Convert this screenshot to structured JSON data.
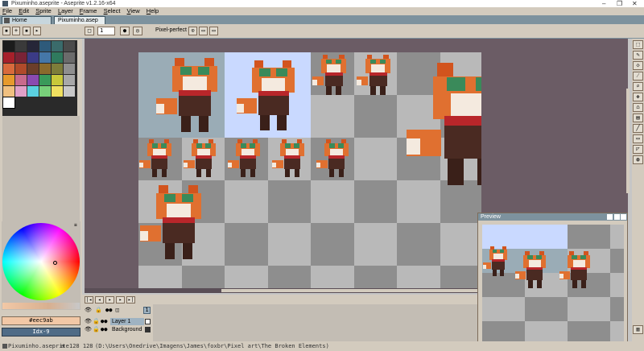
{
  "window": {
    "title": "Pixuminho.aseprite - Aseprite v1.2.16-x64",
    "controls": [
      "–",
      "❐",
      "✕"
    ]
  },
  "menu": [
    "File",
    "Edit",
    "Sprite",
    "Layer",
    "Frame",
    "Select",
    "View",
    "Help"
  ],
  "tabs": [
    {
      "label": "Home"
    },
    {
      "label": "Pixuminho.asep"
    }
  ],
  "context": {
    "brush_size": "1",
    "pixel_perfect_label": "Pixel-perfect"
  },
  "palette": {
    "colors": [
      "#1c1c1c",
      "#3a3a3a",
      "#262638",
      "#2e5a7a",
      "#3a6b6b",
      "#4b4b4b",
      "#a6202a",
      "#7a2336",
      "#3b3b86",
      "#4577a8",
      "#2f7a5e",
      "#6b6b6b",
      "#d86a3c",
      "#b04a2a",
      "#6b3e2a",
      "#8a6a2c",
      "#7d7d3a",
      "#8f8f8f",
      "#e69a2c",
      "#c86a8c",
      "#8a4ab0",
      "#3a9a5a",
      "#c8c83a",
      "#a8a8a8",
      "#f0c080",
      "#e0a0c8",
      "#5ad0e0",
      "#78d07a",
      "#f0e060",
      "#c8c8c8",
      "#ffffff"
    ]
  },
  "colors": {
    "foreground_label": "#eec9ab",
    "background_label": "Idx-9",
    "foreground": "#f2c8a6",
    "background": "#4f6b86",
    "accent": "#7d929e",
    "workspace_bg": "#6b5c65"
  },
  "timeline": {
    "layers": [
      {
        "name": "",
        "selected": false
      },
      {
        "name": "Layer 1",
        "selected": true
      },
      {
        "name": "Background",
        "selected": false
      }
    ],
    "frame_number": "1"
  },
  "preview": {
    "title": "Preview"
  },
  "status": {
    "file": "Pixuminho.aseprite",
    "size": "128 128",
    "path": "(D:\\Users\\Onedrive\\Imagens\\James\\foxbr\\Pixel art\\The Broken Elements)"
  }
}
